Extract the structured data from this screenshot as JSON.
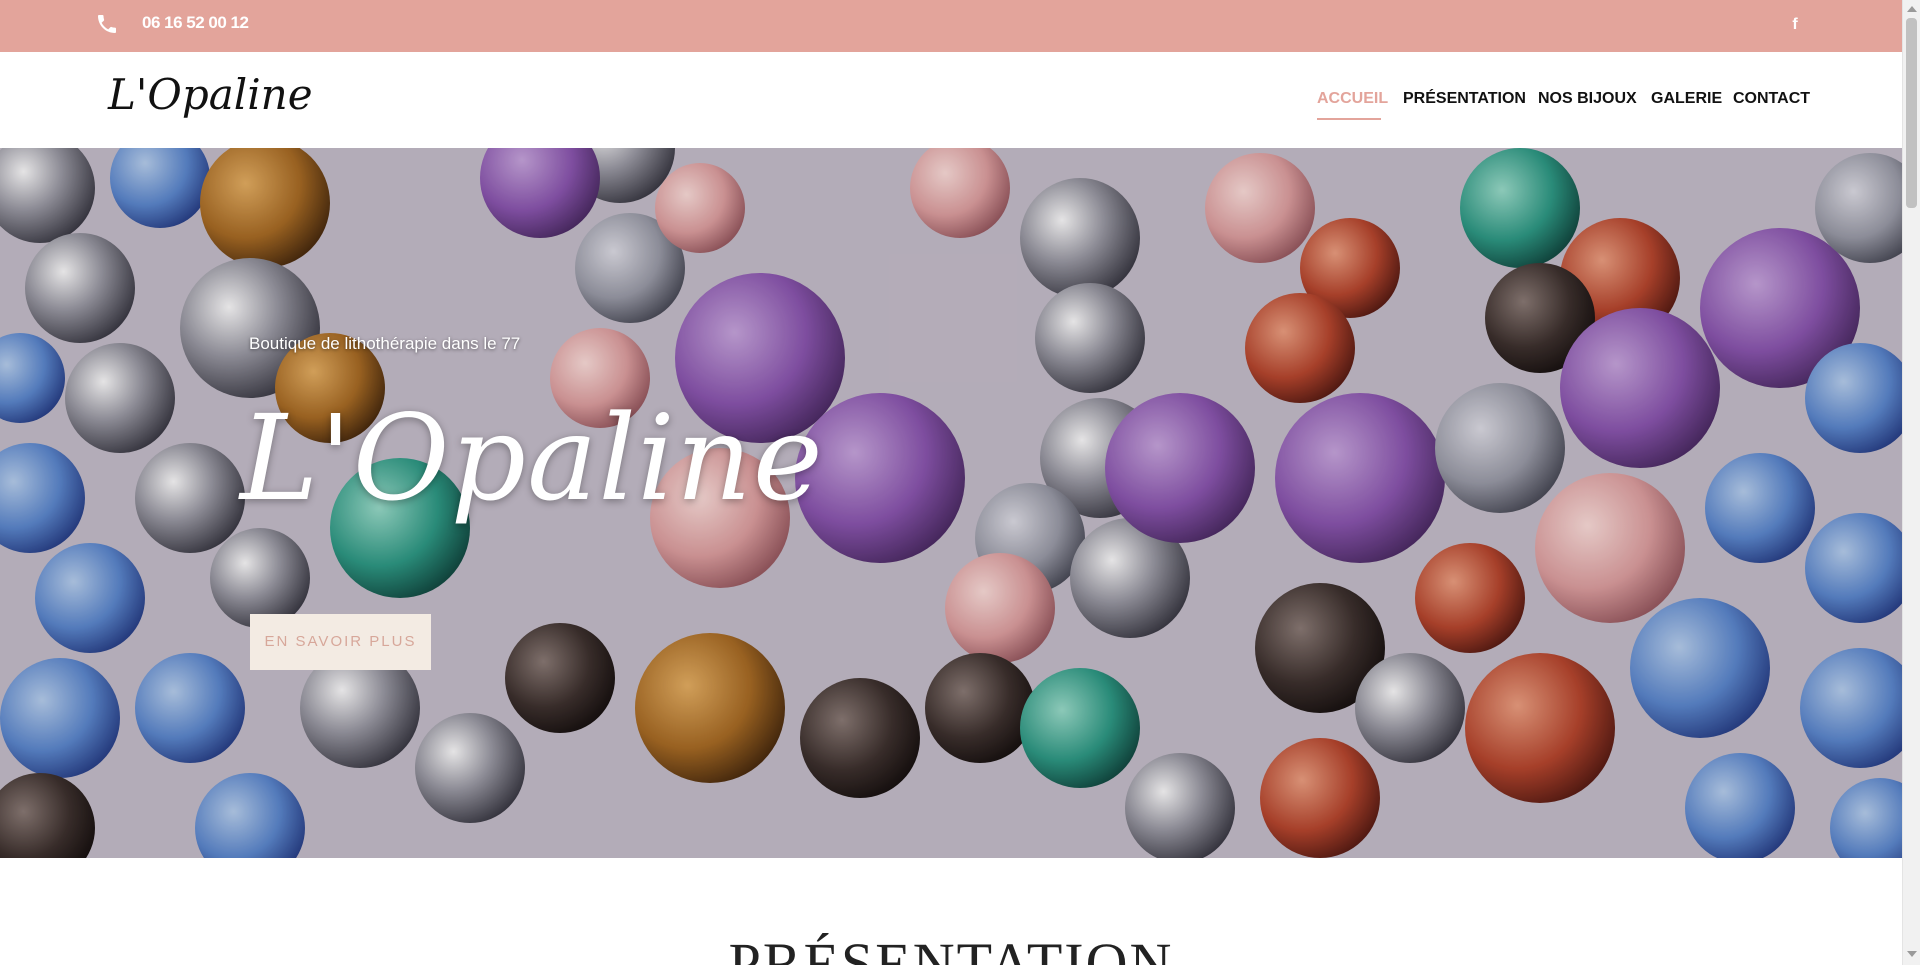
{
  "topbar": {
    "phone": "06 16 52 00 12",
    "phone_icon": "phone-icon",
    "social_icon": "facebook-icon",
    "social_glyph": "f",
    "background": "#e3a49b"
  },
  "header": {
    "logo": "L'Opaline",
    "nav": [
      {
        "label": "ACCUEIL",
        "active": true
      },
      {
        "label": "PRÉSENTATION",
        "active": false
      },
      {
        "label": "NOS BIJOUX",
        "active": false
      },
      {
        "label": "GALERIE",
        "active": false
      },
      {
        "label": "CONTACT",
        "active": false
      }
    ],
    "accent": "#e3a49b"
  },
  "hero": {
    "subtitle": "Boutique de lithothérapie dans le 77",
    "title": "L'Opaline",
    "button_label": "EN SAVOIR PLUS",
    "button_bg": "#f3ebe3",
    "button_text_color": "#d7a79a"
  },
  "section": {
    "title": "PRÉSENTATION"
  }
}
